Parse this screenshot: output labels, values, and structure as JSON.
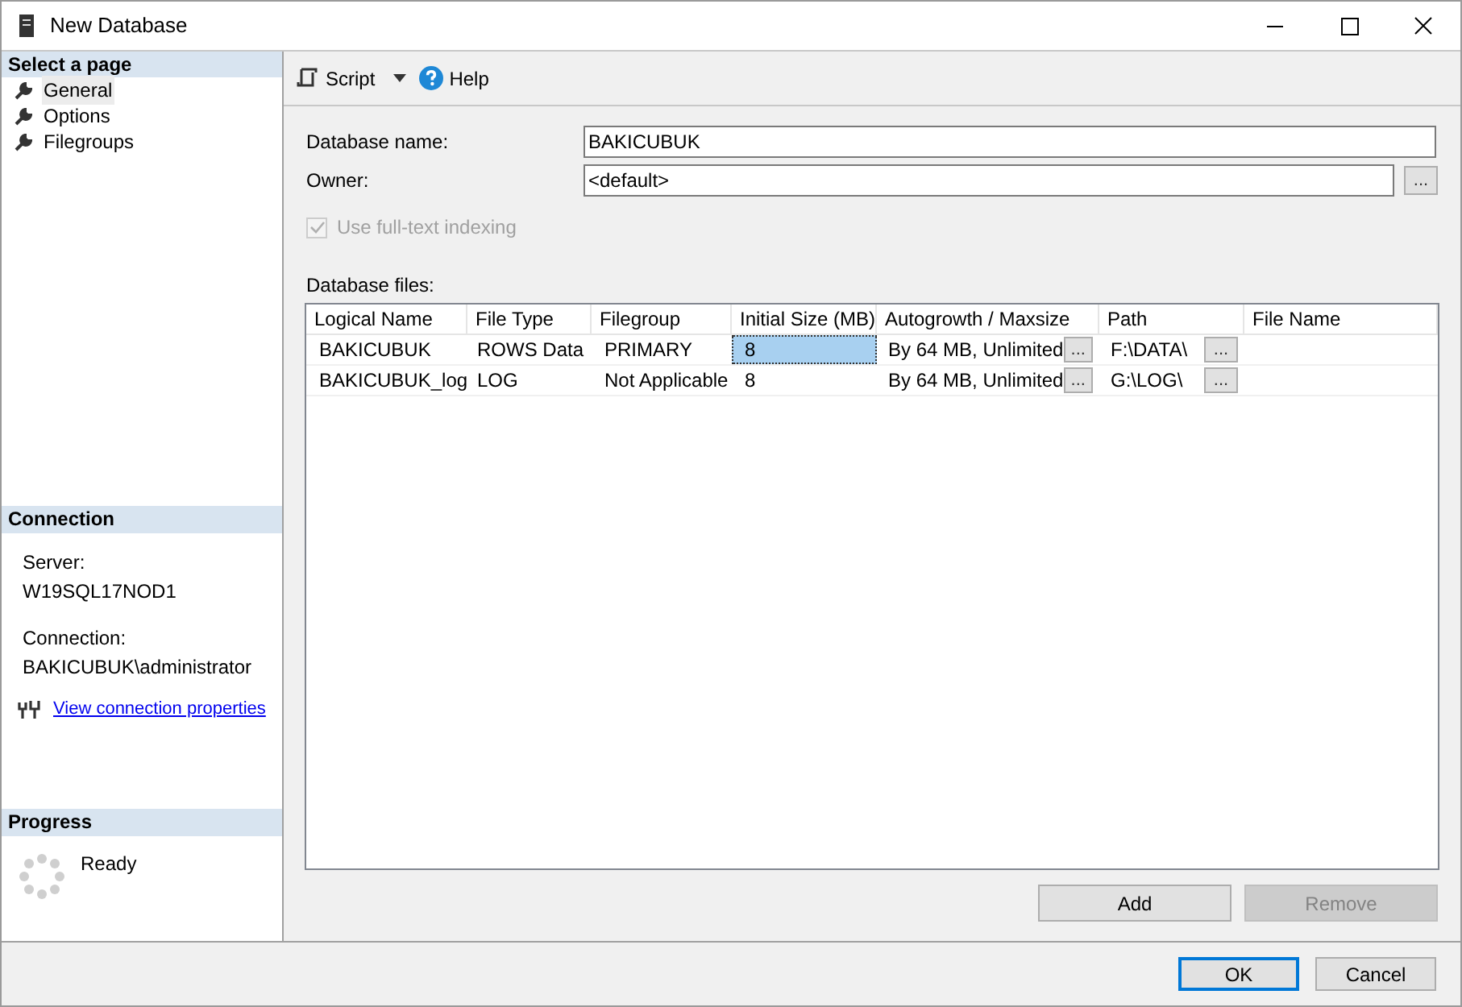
{
  "window": {
    "title": "New Database"
  },
  "sidebar": {
    "header": "Select a page",
    "items": [
      {
        "label": "General",
        "selected": true
      },
      {
        "label": "Options",
        "selected": false
      },
      {
        "label": "Filegroups",
        "selected": false
      }
    ]
  },
  "connection": {
    "header": "Connection",
    "server_label": "Server:",
    "server": "W19SQL17NOD1",
    "connection_label": "Connection:",
    "connection": "BAKICUBUK\\administrator",
    "link": "View connection properties"
  },
  "progress": {
    "header": "Progress",
    "status": "Ready"
  },
  "toolbar": {
    "script": "Script",
    "help": "Help"
  },
  "form": {
    "database_name_label": "Database name:",
    "database_name": "BAKICUBUK",
    "owner_label": "Owner:",
    "owner": "<default>",
    "owner_browse": "...",
    "fulltext": {
      "label": "Use full-text indexing",
      "checked": true,
      "disabled": true
    }
  },
  "files": {
    "label": "Database files:",
    "columns": [
      "Logical Name",
      "File Type",
      "Filegroup",
      "Initial Size (MB)",
      "Autogrowth / Maxsize",
      "Path",
      "File Name"
    ],
    "rows": [
      {
        "logical_name": "BAKICUBUK",
        "file_type": "ROWS Data",
        "filegroup": "PRIMARY",
        "initial_size": "8",
        "size_selected": true,
        "autogrowth": "By 64 MB, Unlimited",
        "autogrowth_button": "...",
        "path": "F:\\DATA\\",
        "path_button": "..."
      },
      {
        "logical_name": "BAKICUBUK_log",
        "file_type": "LOG",
        "filegroup": "Not Applicable",
        "initial_size": "8",
        "size_selected": false,
        "autogrowth": "By 64 MB, Unlimited",
        "autogrowth_button": "...",
        "path": "G:\\LOG\\",
        "path_button": "..."
      }
    ]
  },
  "table_buttons": [
    {
      "label": "Add",
      "disabled": false
    },
    {
      "label": "Remove",
      "disabled": true
    }
  ],
  "dialog_buttons": [
    {
      "label": "OK",
      "default": true
    },
    {
      "label": "Cancel",
      "default": false
    }
  ]
}
